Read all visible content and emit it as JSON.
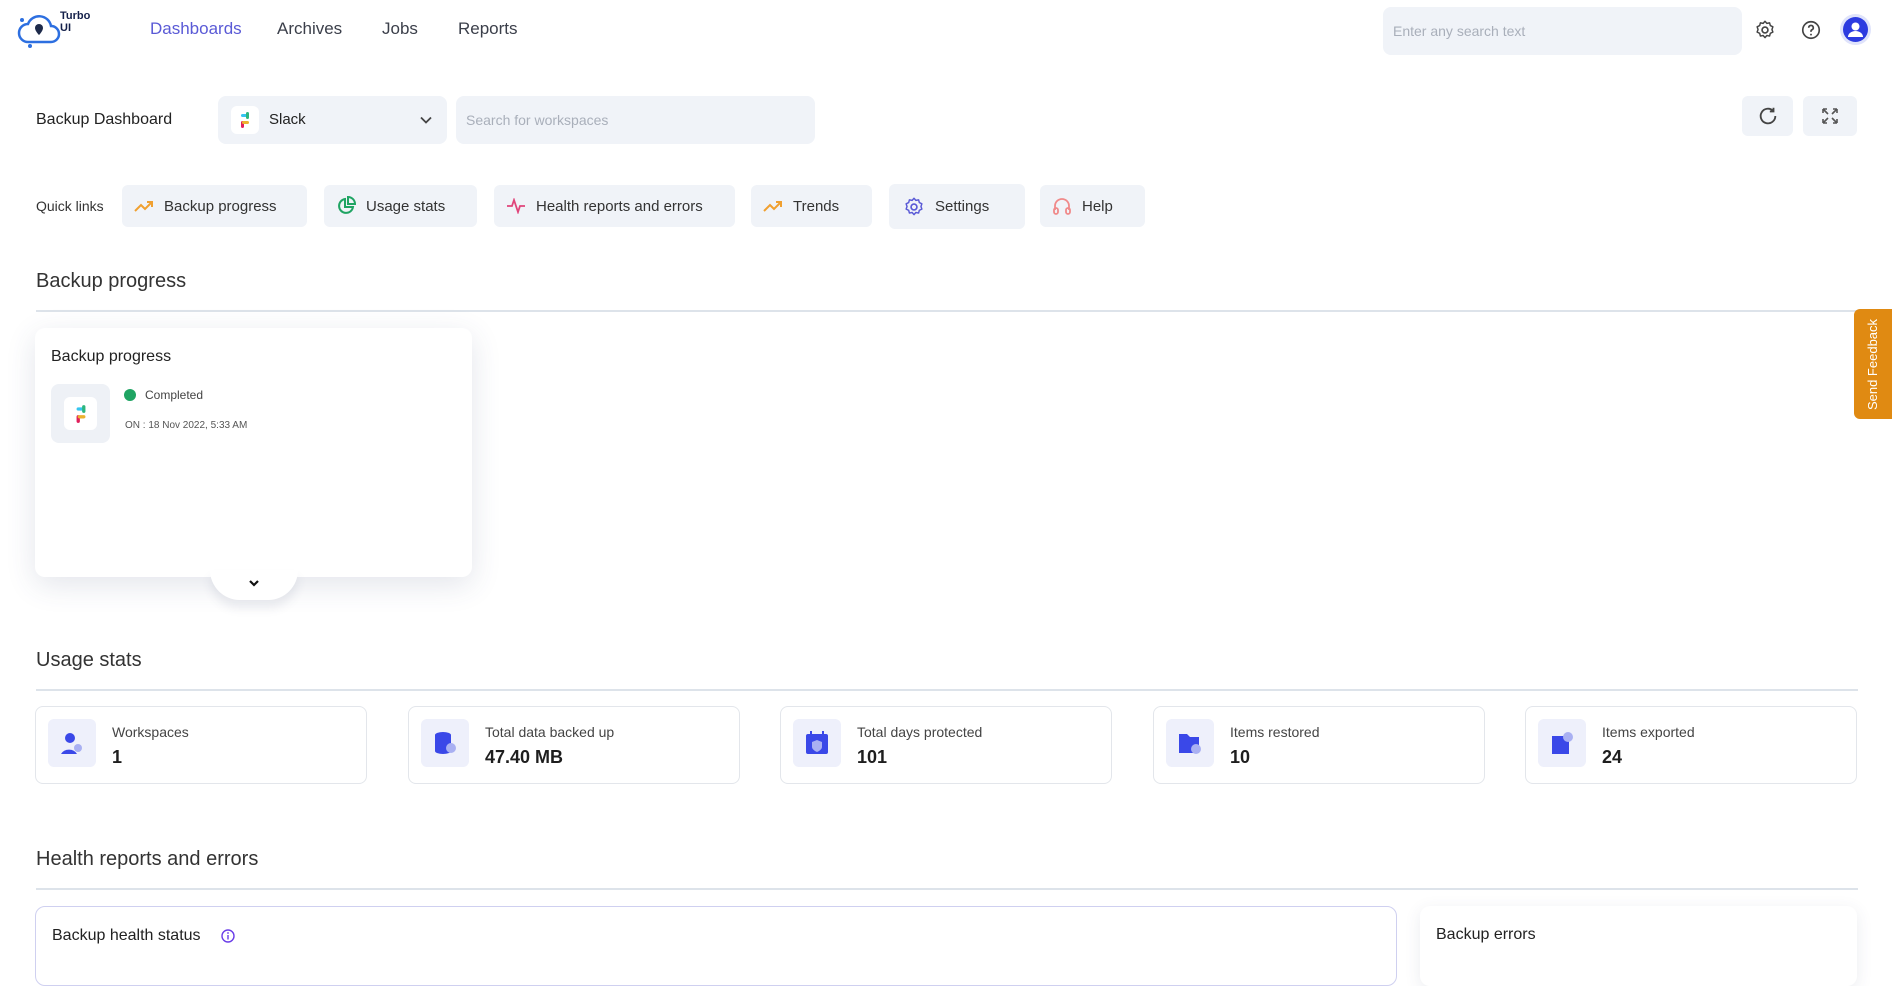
{
  "app": {
    "name": "Turbo UI"
  },
  "nav": [
    {
      "label": "Dashboards",
      "active": true
    },
    {
      "label": "Archives"
    },
    {
      "label": "Jobs"
    },
    {
      "label": "Reports"
    }
  ],
  "header": {
    "search_placeholder": "Enter any search text"
  },
  "toolbar": {
    "title": "Backup Dashboard",
    "app_select": "Slack",
    "workspace_search_placeholder": "Search for workspaces"
  },
  "quick_links": {
    "label": "Quick links",
    "items": [
      {
        "label": "Backup progress"
      },
      {
        "label": "Usage stats"
      },
      {
        "label": "Health reports and errors"
      },
      {
        "label": "Trends"
      },
      {
        "label": "Settings"
      },
      {
        "label": "Help"
      }
    ]
  },
  "backup_progress": {
    "section_title": "Backup progress",
    "card_title": "Backup progress",
    "status": "Completed",
    "date": "ON : 18 Nov 2022, 5:33 AM",
    "status_color": "#1fa463"
  },
  "usage_stats": {
    "section_title": "Usage stats",
    "items": [
      {
        "label": "Workspaces",
        "value": "1"
      },
      {
        "label": "Total data backed up",
        "value": "47.40 MB"
      },
      {
        "label": "Total days protected",
        "value": "101"
      },
      {
        "label": "Items restored",
        "value": "10"
      },
      {
        "label": "Items exported",
        "value": "24"
      }
    ]
  },
  "health": {
    "section_title": "Health reports and errors",
    "status_card_title": "Backup health status",
    "errors_card_title": "Backup errors"
  },
  "feedback": {
    "label": "Send Feedback",
    "color": "#e08a12"
  }
}
